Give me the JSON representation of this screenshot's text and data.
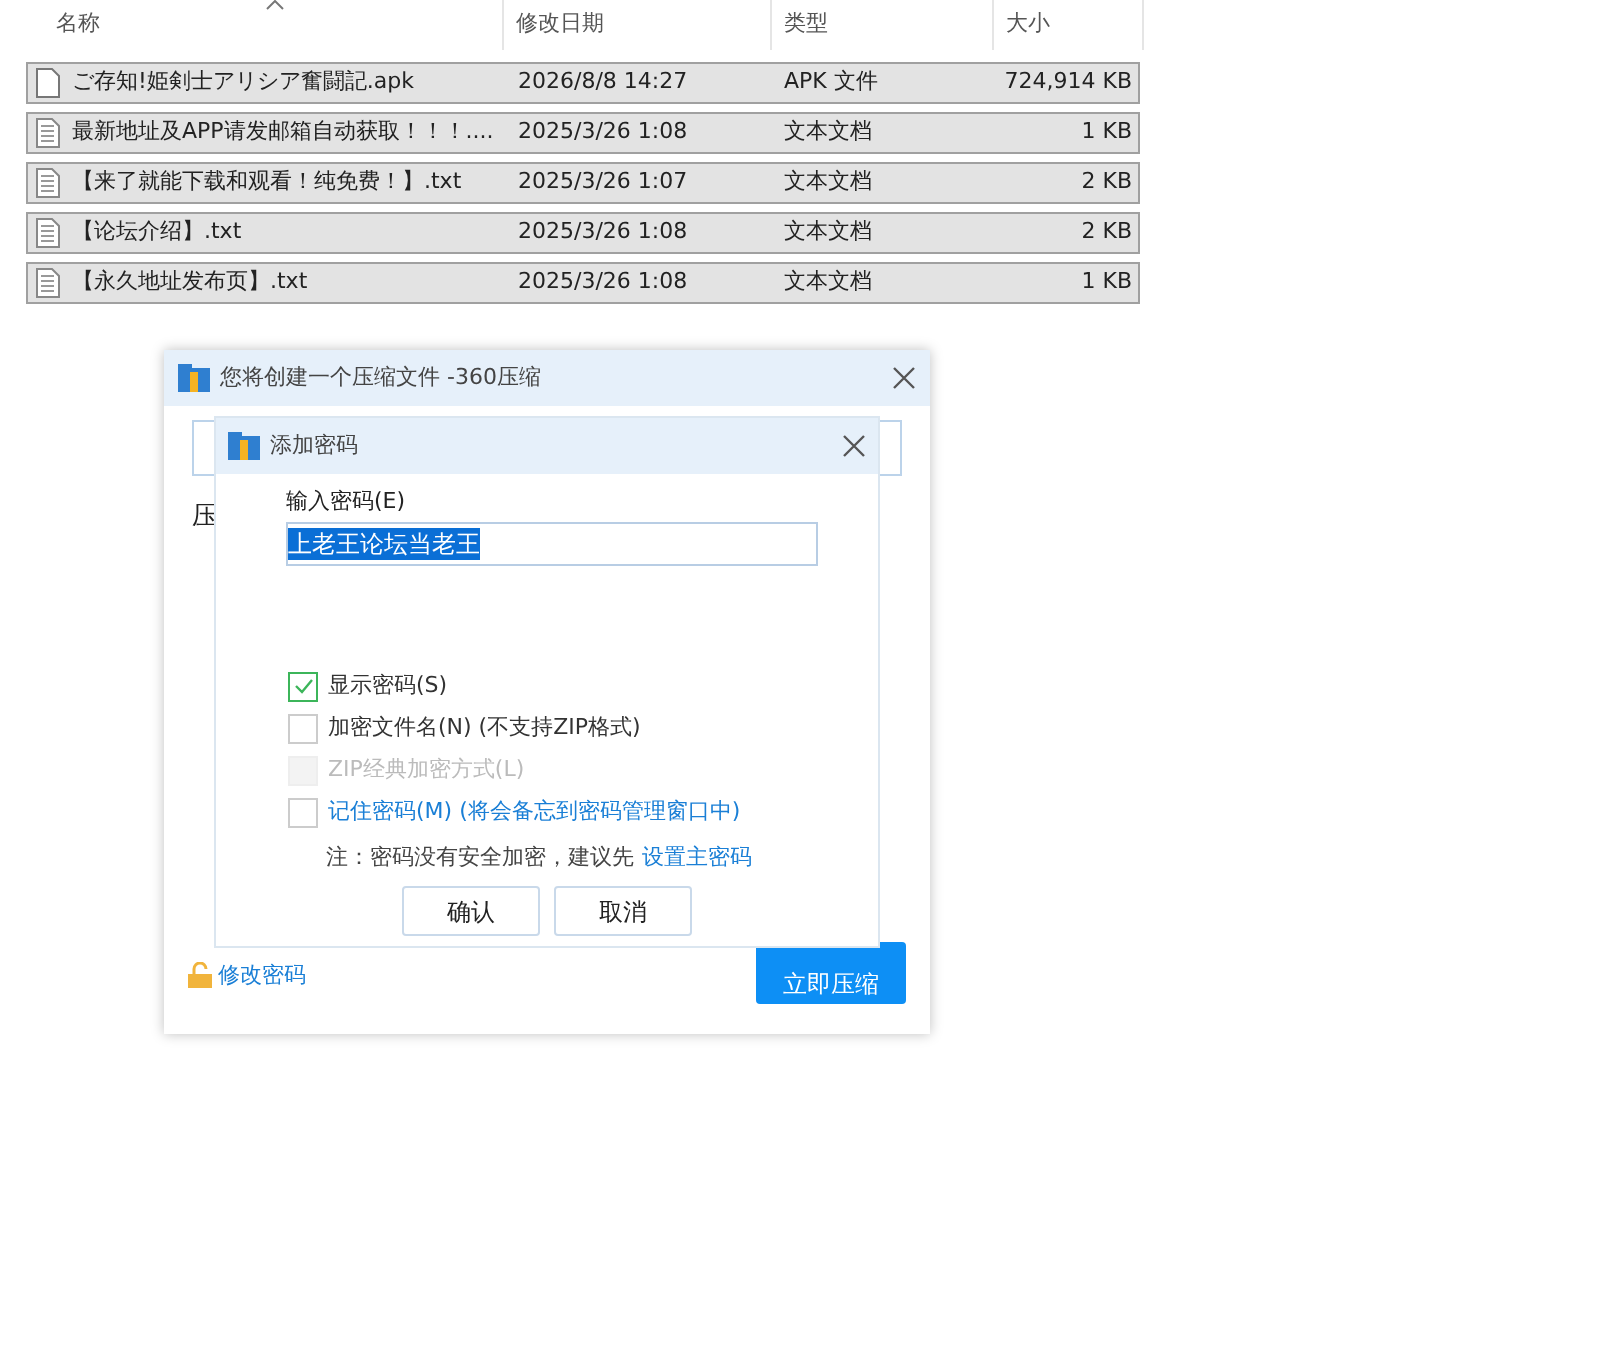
{
  "file_list": {
    "columns": [
      {
        "label": "名称",
        "sorted": true
      },
      {
        "label": "修改日期",
        "sorted": false
      },
      {
        "label": "类型",
        "sorted": false
      },
      {
        "label": "大小",
        "sorted": false
      }
    ],
    "rows": [
      {
        "kind": "apk",
        "name": "ご存知!姫剣士アリシア奮闘記.apk",
        "date": "2026/8/8 14:27",
        "type": "APK 文件",
        "size": "724,914 KB",
        "selected": true
      },
      {
        "kind": "txt",
        "name": "最新地址及APP请发邮箱自动获取！！！....",
        "date": "2025/3/26 1:08",
        "type": "文本文档",
        "size": "1 KB",
        "selected": true
      },
      {
        "kind": "txt",
        "name": "【来了就能下载和观看！纯免费！】.txt",
        "date": "2025/3/26 1:07",
        "type": "文本文档",
        "size": "2 KB",
        "selected": true
      },
      {
        "kind": "txt",
        "name": "【论坛介绍】.txt",
        "date": "2025/3/26 1:08",
        "type": "文本文档",
        "size": "2 KB",
        "selected": true
      },
      {
        "kind": "txt",
        "name": "【永久地址发布页】.txt",
        "date": "2025/3/26 1:08",
        "type": "文本文档",
        "size": "1 KB",
        "selected": true
      }
    ]
  },
  "compress_dialog": {
    "title": "您将创建一个压缩文件 -360压缩",
    "label": "压",
    "change_password_link": "修改密码",
    "compress_button": "立即压缩"
  },
  "password_dialog": {
    "title": "添加密码",
    "password_label": "输入密码(E)",
    "password_value": "上老王论坛当老王",
    "options": [
      {
        "label": "显示密码(S)",
        "checked": true,
        "disabled": false,
        "link": false
      },
      {
        "label": "加密文件名(N) (不支持ZIP格式)",
        "checked": false,
        "disabled": false,
        "link": false
      },
      {
        "label": "ZIP经典加密方式(L)",
        "checked": false,
        "disabled": true,
        "link": false
      },
      {
        "label": "记住密码(M) (将会备忘到密码管理窗口中)",
        "checked": false,
        "disabled": false,
        "link": true
      }
    ],
    "note": "注：密码没有安全加密，建议先",
    "note_link": "设置主密码",
    "buttons": [
      "确认",
      "取消"
    ]
  }
}
